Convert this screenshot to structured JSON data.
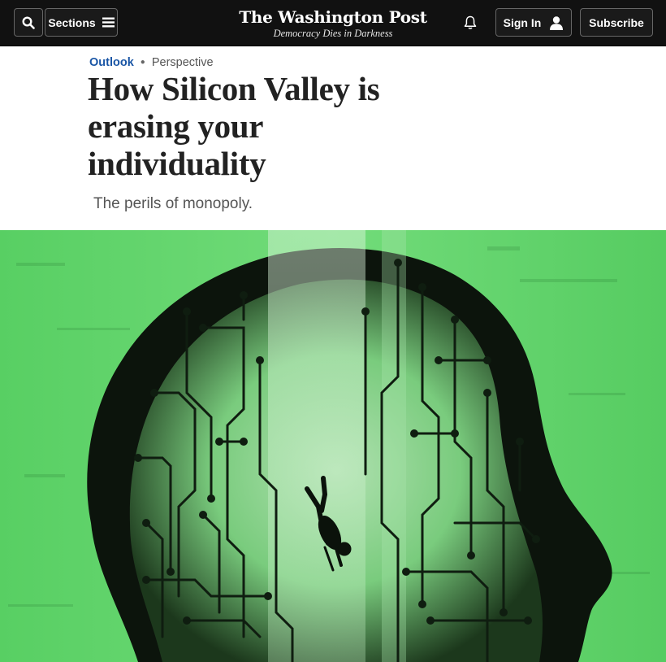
{
  "nav": {
    "sections_label": "Sections",
    "masthead": "The Washington Post",
    "tagline": "Democracy Dies in Darkness",
    "signin_label": "Sign In",
    "subscribe_label": "Subscribe",
    "icons": [
      "search-icon",
      "hamburger-icon",
      "bell-icon",
      "user-icon"
    ]
  },
  "article": {
    "section": "Outlook",
    "label": "Perspective",
    "headline": "How Silicon Valley is erasing your individuality",
    "dek": "The perils of monopoly."
  },
  "colors": {
    "topbar": "#111111",
    "section_link": "#1955a5",
    "hero_green": "#5fd36a",
    "hero_dark": "#0c140c"
  }
}
